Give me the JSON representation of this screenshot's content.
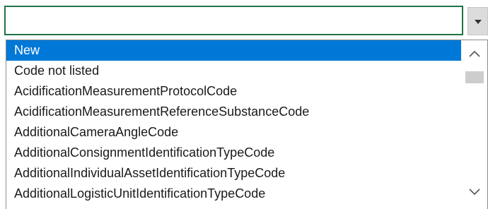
{
  "cell": {
    "value": ""
  },
  "dropdown": {
    "button_icon": "chevron-down-icon"
  },
  "list": {
    "selected_index": 0,
    "items": [
      "New",
      "Code not listed",
      "AcidificationMeasurementProtocolCode",
      "AcidificationMeasurementReferenceSubstanceCode",
      "AdditionalCameraAngleCode",
      "AdditionalConsignmentIdentificationTypeCode",
      "AdditionalIndividualAssetIdentificationTypeCode",
      "AdditionalLogisticUnitIdentificationTypeCode"
    ],
    "scroll_position": 0.02
  },
  "colors": {
    "accent_border": "#217346",
    "selection": "#0078d7"
  },
  "scrollbar": {
    "up_icon": "chevron-up-icon",
    "down_icon": "chevron-down-icon"
  }
}
